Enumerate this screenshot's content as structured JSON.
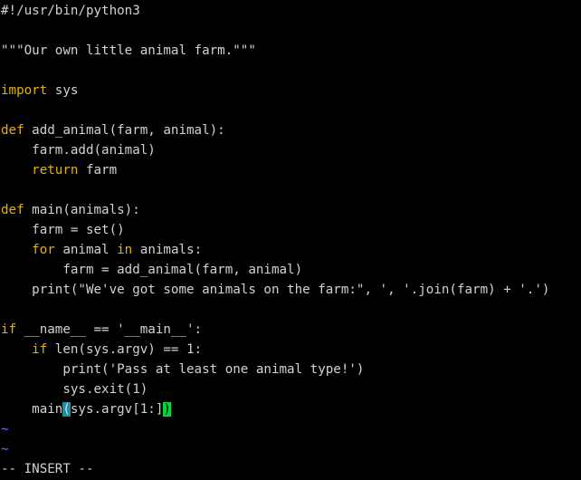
{
  "editor": {
    "lines": [
      "#!/usr/bin/python3",
      "",
      "\"\"\"Our own little animal farm.\"\"\"",
      "",
      "import sys",
      "",
      "def add_animal(farm, animal):",
      "    farm.add(animal)",
      "    return farm",
      "",
      "def main(animals):",
      "    farm = set()",
      "    for animal in animals:",
      "        farm = add_animal(farm, animal)",
      "    print(\"We've got some animals on the farm:\", ', '.join(farm) + '.')",
      "",
      "if __name__ == '__main__':",
      "    if len(sys.argv) == 1:",
      "        print('Pass at least one animal type!')",
      "        sys.exit(1)",
      "    main(sys.argv[1:])"
    ],
    "empty_line_marker": "~",
    "empty_markers_count": 2
  },
  "status": {
    "mode": "-- INSERT --"
  },
  "colors": {
    "background": "#000000",
    "keyword": "#e5b200",
    "cursor": "#00d63a",
    "bracket_match": "#1e8fa0",
    "tilde": "#5555ff"
  }
}
